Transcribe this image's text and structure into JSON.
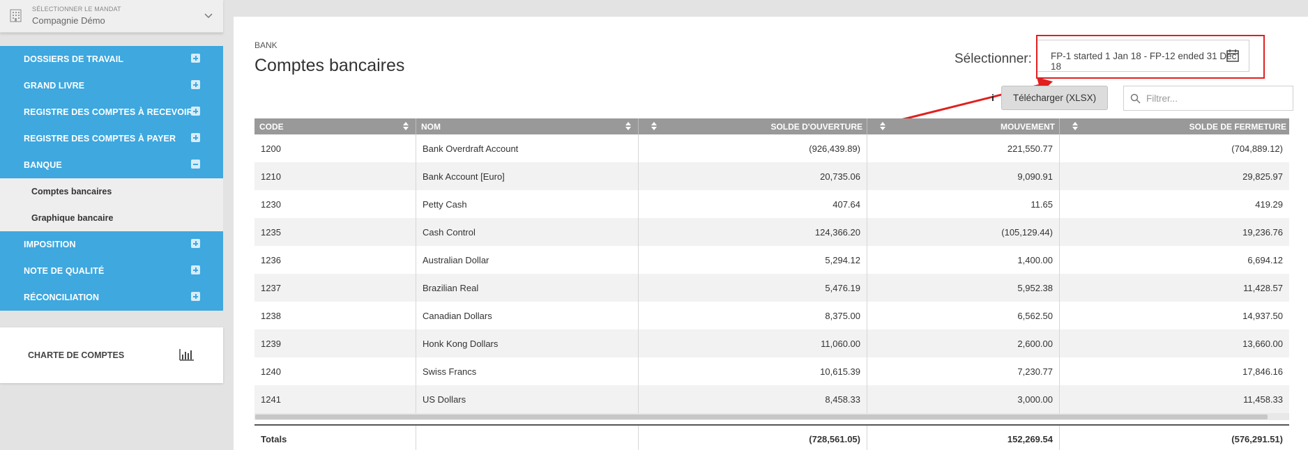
{
  "mandat": {
    "label": "SÉLECTIONNER LE MANDAT",
    "company": "Compagnie Démo"
  },
  "sidebar": {
    "items": [
      {
        "label": "DOSSIERS DE TRAVAIL",
        "toggle": "plus"
      },
      {
        "label": "GRAND LIVRE",
        "toggle": "plus"
      },
      {
        "label": "REGISTRE DES COMPTES À RECEVOIR",
        "toggle": "plus"
      },
      {
        "label": "REGISTRE DES COMPTES À PAYER",
        "toggle": "plus"
      },
      {
        "label": "BANQUE",
        "toggle": "minus"
      },
      {
        "label": "IMPOSITION",
        "toggle": "plus"
      },
      {
        "label": "NOTE DE QUALITÉ",
        "toggle": "plus"
      },
      {
        "label": "RÉCONCILIATION",
        "toggle": "plus"
      }
    ],
    "subitems": [
      "Comptes bancaires",
      "Graphique bancaire"
    ],
    "chart_of_accounts": "CHARTE DE COMPTES"
  },
  "page": {
    "breadcrumb": "BANK",
    "title": "Comptes bancaires",
    "select_label": "Sélectionner:",
    "period": "FP-1 started 1 Jan 18 - FP-12 ended 31 Dec 18",
    "info": "i",
    "download_label": "Télécharger (XLSX)",
    "filter_placeholder": "Filtrer..."
  },
  "table": {
    "headers": [
      "CODE",
      "NOM",
      "SOLDE D'OUVERTURE",
      "MOUVEMENT",
      "SOLDE DE FERMETURE"
    ],
    "rows": [
      [
        "1200",
        "Bank Overdraft Account",
        "(926,439.89)",
        "221,550.77",
        "(704,889.12)"
      ],
      [
        "1210",
        "Bank Account [Euro]",
        "20,735.06",
        "9,090.91",
        "29,825.97"
      ],
      [
        "1230",
        "Petty Cash",
        "407.64",
        "11.65",
        "419.29"
      ],
      [
        "1235",
        "Cash Control",
        "124,366.20",
        "(105,129.44)",
        "19,236.76"
      ],
      [
        "1236",
        "Australian Dollar",
        "5,294.12",
        "1,400.00",
        "6,694.12"
      ],
      [
        "1237",
        "Brazilian Real",
        "5,476.19",
        "5,952.38",
        "11,428.57"
      ],
      [
        "1238",
        "Canadian Dollars",
        "8,375.00",
        "6,562.50",
        "14,937.50"
      ],
      [
        "1239",
        "Honk Kong Dollars",
        "11,060.00",
        "2,600.00",
        "13,660.00"
      ],
      [
        "1240",
        "Swiss Francs",
        "10,615.39",
        "7,230.77",
        "17,846.16"
      ],
      [
        "1241",
        "US Dollars",
        "8,458.33",
        "3,000.00",
        "11,458.33"
      ]
    ],
    "totals": {
      "label": "Totals",
      "opening": "(728,561.05)",
      "movement": "152,269.54",
      "closing": "(576,291.51)"
    }
  },
  "colors": {
    "sidebar_blue": "#3ea8df",
    "header_gray": "#999999",
    "highlight_red": "#e01f1f"
  }
}
